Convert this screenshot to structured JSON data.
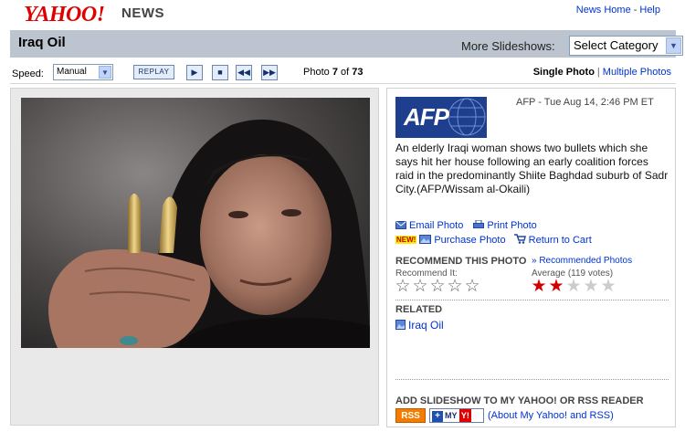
{
  "header": {
    "logo": "YAHOO!",
    "section": "NEWS",
    "links": [
      "News Home",
      "Help"
    ]
  },
  "titlebar": {
    "title": "Iraq Oil",
    "more_label": "More Slideshows:",
    "category_value": "Select Category"
  },
  "controls": {
    "speed_label": "Speed:",
    "speed_value": "Manual",
    "replay_label": "REPLAY",
    "photo_prefix": "Photo",
    "photo_current": "7",
    "photo_of": "of",
    "photo_total": "73",
    "single_photo": "Single Photo",
    "multiple_photos": "Multiple Photos"
  },
  "info": {
    "source_logo": "AFP",
    "dateline": "AFP - Tue Aug 14, 2:46 PM ET",
    "caption": "An elderly Iraqi woman shows two bullets which she says hit her house following an early coalition forces raid in the predominantly Shiite Baghdad suburb of Sadr City.(AFP/Wissam al-Okaili)",
    "email_photo": "Email Photo",
    "print_photo": "Print Photo",
    "new_badge": "NEW!",
    "purchase_photo": "Purchase Photo",
    "return_to_cart": "Return to Cart",
    "recommend_heading": "RECOMMEND THIS PHOTO",
    "recommended_link": "» Recommended Photos",
    "recommend_it": "Recommend It:",
    "average_label": "Average (119 votes)",
    "average_rating": 2,
    "rating_max": 5,
    "related_heading": "RELATED",
    "related_link": "Iraq Oil",
    "add_heading": "ADD SLIDESHOW TO MY YAHOO! OR RSS READER",
    "rss_label": "RSS",
    "myyahoo_label": "MY",
    "myyahoo_y": "Y!",
    "about_link": "(About My Yahoo! and RSS)"
  },
  "colors": {
    "link": "#0033cc",
    "titlebar": "#bcc4cf",
    "star_on": "#d40000",
    "star_off": "#cccccc"
  }
}
